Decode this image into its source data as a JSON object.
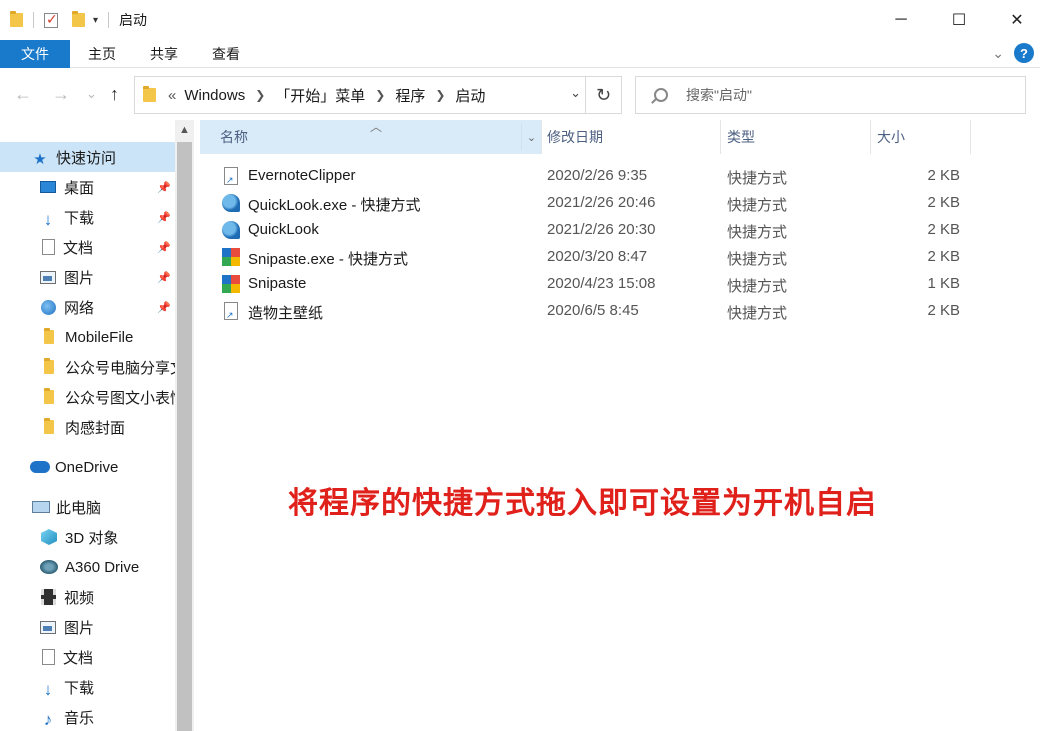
{
  "window": {
    "title": "启动",
    "controls": {
      "minimize": "─",
      "maximize": "☐",
      "close": "✕"
    }
  },
  "ribbon": {
    "tabs": [
      {
        "label": "文件",
        "active": true
      },
      {
        "label": "主页"
      },
      {
        "label": "共享"
      },
      {
        "label": "查看"
      }
    ],
    "help": "?"
  },
  "nav": {
    "back": "←",
    "forward": "→",
    "recent": "⌄",
    "up": "↑",
    "overflow": "«",
    "breadcrumbs": [
      "Windows",
      "「开始」菜单",
      "程序",
      "启动"
    ],
    "refresh": "↻"
  },
  "search": {
    "placeholder": "搜索\"启动\""
  },
  "sidebar": {
    "items": [
      {
        "label": "快速访问",
        "icon": "star-icon",
        "pinned": false,
        "selected": true
      },
      {
        "label": "桌面",
        "icon": "desktop-icon",
        "pinned": true
      },
      {
        "label": "下载",
        "icon": "download-icon",
        "pinned": true
      },
      {
        "label": "文档",
        "icon": "document-icon",
        "pinned": true
      },
      {
        "label": "图片",
        "icon": "picture-icon",
        "pinned": true
      },
      {
        "label": "网络",
        "icon": "network-icon",
        "pinned": true
      },
      {
        "label": "MobileFile",
        "icon": "folder-icon"
      },
      {
        "label": "公众号电脑分享文",
        "icon": "folder-icon"
      },
      {
        "label": "公众号图文小表情",
        "icon": "folder-icon"
      },
      {
        "label": "肉感封面",
        "icon": "folder-icon"
      },
      {
        "label": "OneDrive",
        "icon": "onedrive-icon"
      },
      {
        "label": "此电脑",
        "icon": "computer-icon"
      },
      {
        "label": "3D 对象",
        "icon": "3d-objects-icon"
      },
      {
        "label": "A360 Drive",
        "icon": "drive-icon"
      },
      {
        "label": "视频",
        "icon": "video-icon"
      },
      {
        "label": "图片",
        "icon": "picture-icon"
      },
      {
        "label": "文档",
        "icon": "document-icon"
      },
      {
        "label": "下载",
        "icon": "download-icon"
      },
      {
        "label": "音乐",
        "icon": "music-icon"
      }
    ]
  },
  "columns": {
    "name": "名称",
    "date": "修改日期",
    "type": "类型",
    "size": "大小"
  },
  "files": [
    {
      "name": "EvernoteClipper",
      "date": "2020/2/26 9:35",
      "type": "快捷方式",
      "size": "2 KB",
      "icon": "shortcut-file-icon"
    },
    {
      "name": "QuickLook.exe - 快捷方式",
      "date": "2021/2/26 20:46",
      "type": "快捷方式",
      "size": "2 KB",
      "icon": "quicklook-icon"
    },
    {
      "name": "QuickLook",
      "date": "2021/2/26 20:30",
      "type": "快捷方式",
      "size": "2 KB",
      "icon": "quicklook-icon"
    },
    {
      "name": "Snipaste.exe - 快捷方式",
      "date": "2020/3/20 8:47",
      "type": "快捷方式",
      "size": "2 KB",
      "icon": "snipaste-icon"
    },
    {
      "name": "Snipaste",
      "date": "2020/4/23 15:08",
      "type": "快捷方式",
      "size": "1 KB",
      "icon": "snipaste-icon"
    },
    {
      "name": "造物主壁纸",
      "date": "2020/6/5 8:45",
      "type": "快捷方式",
      "size": "2 KB",
      "icon": "shortcut-file-icon"
    }
  ],
  "annotation": "将程序的快捷方式拖入即可设置为开机自启"
}
